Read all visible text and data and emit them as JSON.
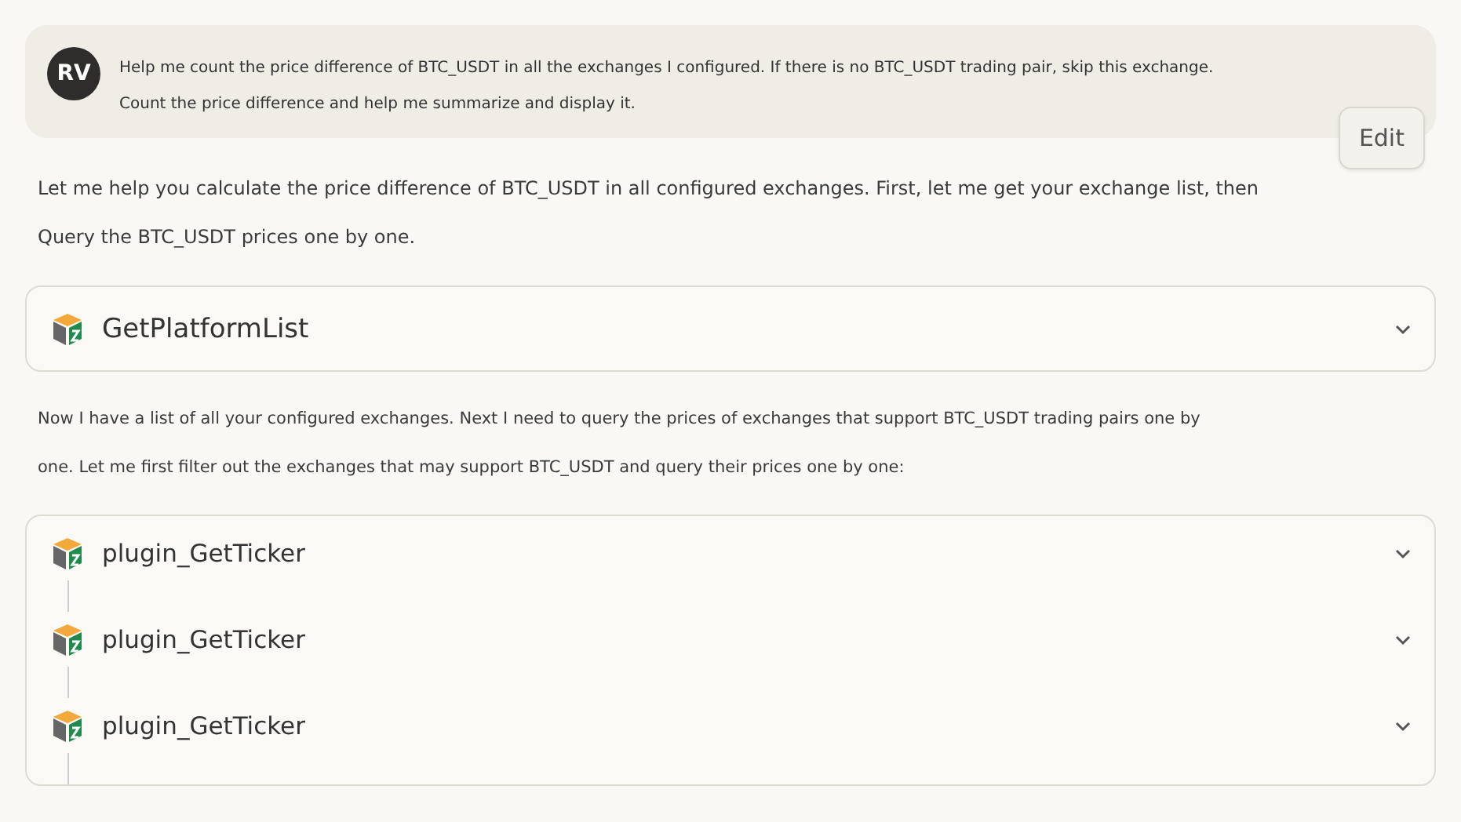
{
  "user_message": {
    "avatar": "RV",
    "lines": [
      "Help me count the price difference of BTC_USDT in all the exchanges I configured. If there is no BTC_USDT trading pair, skip this exchange.",
      "Count the price difference and help me summarize and display it."
    ],
    "edit_button": "Edit"
  },
  "assistant_intro": [
    "Let me help you calculate the price difference of BTC_USDT in all configured exchanges. First, let me get your exchange list, then",
    "Query the BTC_USDT prices one by one."
  ],
  "tool_call": {
    "name": "GetPlatformList",
    "expanded": false
  },
  "assistant_followup": [
    "Now I have a list of all your configured exchanges. Next I need to query the prices of exchanges that support BTC_USDT trading pairs one by",
    "one. Let me first filter out the exchanges that may support BTC_USDT and query their prices one by one:"
  ],
  "tool_group": [
    {
      "name": "plugin_GetTicker",
      "expanded": false
    },
    {
      "name": "plugin_GetTicker",
      "expanded": false
    },
    {
      "name": "plugin_GetTicker",
      "expanded": false
    }
  ]
}
